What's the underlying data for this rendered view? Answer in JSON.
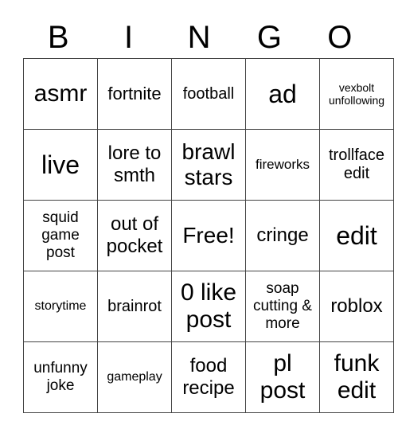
{
  "header": [
    "B",
    "I",
    "N",
    "G",
    "O"
  ],
  "rows": [
    [
      "asmr",
      "fortnite",
      "football",
      "ad",
      "vexbolt unfollowing"
    ],
    [
      "live",
      "lore to smth",
      "brawl stars",
      "fireworks",
      "trollface edit"
    ],
    [
      "squid game post",
      "out of pocket",
      "Free!",
      "cringe",
      "edit"
    ],
    [
      "storytime",
      "brainrot",
      "0 like post",
      "soap cutting & more",
      "roblox"
    ],
    [
      "unfunny joke",
      "gameplay",
      "food recipe",
      "pl post",
      "funk edit"
    ]
  ]
}
